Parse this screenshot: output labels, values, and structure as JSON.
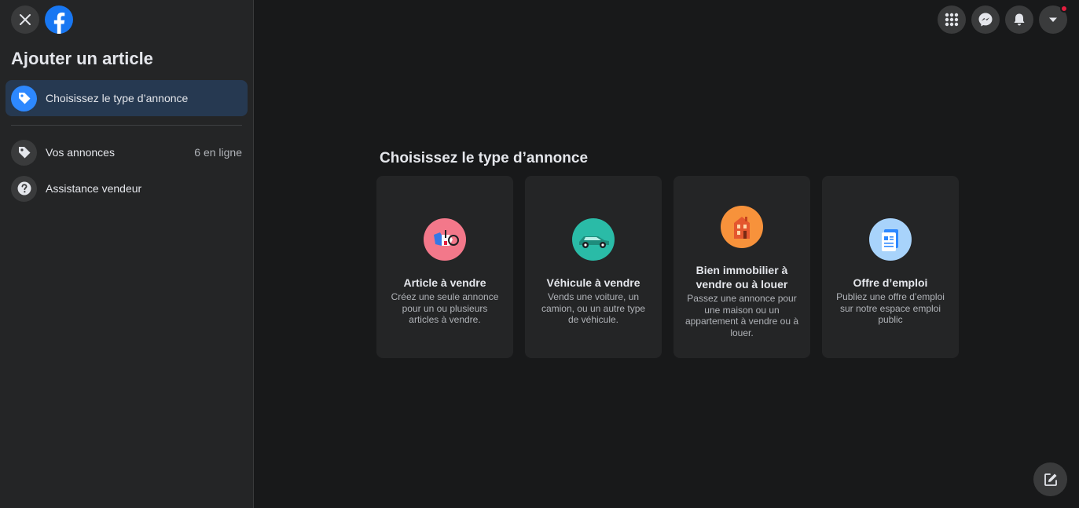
{
  "sidebar": {
    "title": "Ajouter un article",
    "active_item": {
      "label": "Choisissez le type d’annonce",
      "icon": "tag-icon"
    },
    "items": [
      {
        "label": "Vos annonces",
        "meta": "6 en ligne",
        "icon": "tag-icon"
      },
      {
        "label": "Assistance vendeur",
        "meta": "",
        "icon": "help-icon"
      }
    ]
  },
  "topbar": {
    "buttons": [
      "menu-grid-icon",
      "messenger-icon",
      "bell-icon",
      "account-caret-icon"
    ]
  },
  "main": {
    "title": "Choisissez le type d’annonce",
    "cards": [
      {
        "title": "Article à vendre",
        "description": "Créez une seule annonce pour un ou plusieurs articles à vendre.",
        "icon": "item-for-sale-icon",
        "color": "#f3788a"
      },
      {
        "title": "Véhicule à vendre",
        "description": "Vends une voiture, un camion, ou un autre type de véhicule.",
        "icon": "car-icon",
        "color": "#2abba7"
      },
      {
        "title": "Bien immobilier à vendre ou à louer",
        "description": "Passez une annonce pour une maison ou un appartement à vendre ou à louer.",
        "icon": "house-icon",
        "color": "#f7923b"
      },
      {
        "title": "Offre d’emploi",
        "description": "Publiez une offre d’emploi sur notre espace emploi public",
        "icon": "job-document-icon",
        "color": "#a8d3fb"
      }
    ]
  },
  "colors": {
    "background": "#18191a",
    "surface": "#242526",
    "accent": "#2d88ff",
    "active_item_bg": "#263951",
    "notification": "#e41e3f"
  }
}
